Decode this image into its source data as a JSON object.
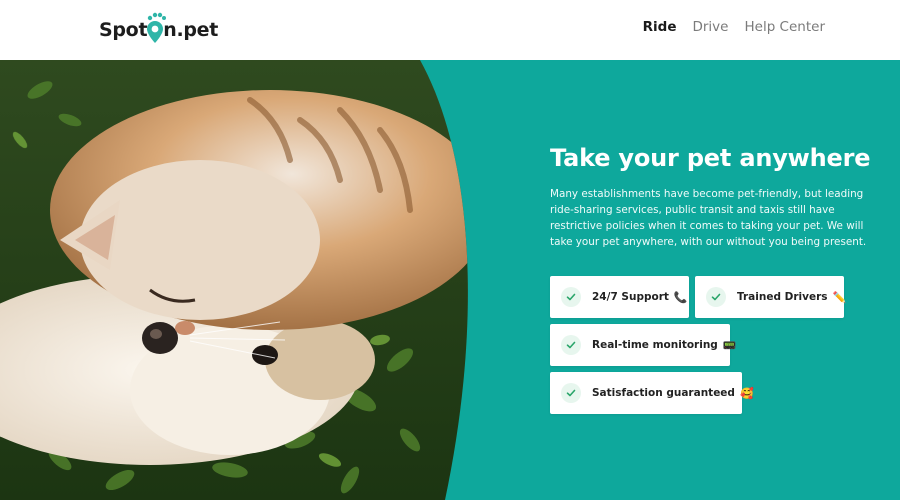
{
  "brand": {
    "name_part1": "Spot",
    "name_part2": "n.pet",
    "accent": "#2fb5a8"
  },
  "nav": [
    {
      "label": "Ride",
      "active": true
    },
    {
      "label": "Drive",
      "active": false
    },
    {
      "label": "Help Center",
      "active": false
    }
  ],
  "hero": {
    "title": "Take your pet anywhere",
    "description": "Many establishments have become pet-friendly, but leading ride-sharing services, public transit and taxis still have restrictive policies when it comes to taking your pet. We will take your pet anywhere, with our without you being present.",
    "background_color": "#0ea89c",
    "image_description": "Cat and dog lying together on green grass"
  },
  "features": [
    {
      "label": "24/7 Support",
      "emoji": "📞",
      "icon": "check-icon"
    },
    {
      "label": "Trained Drivers",
      "emoji": "✏️",
      "icon": "check-icon"
    },
    {
      "label": "Real-time monitoring",
      "emoji": "📟",
      "icon": "check-icon"
    },
    {
      "label": "Satisfaction guaranteed",
      "emoji": "🥰",
      "icon": "check-icon"
    }
  ]
}
